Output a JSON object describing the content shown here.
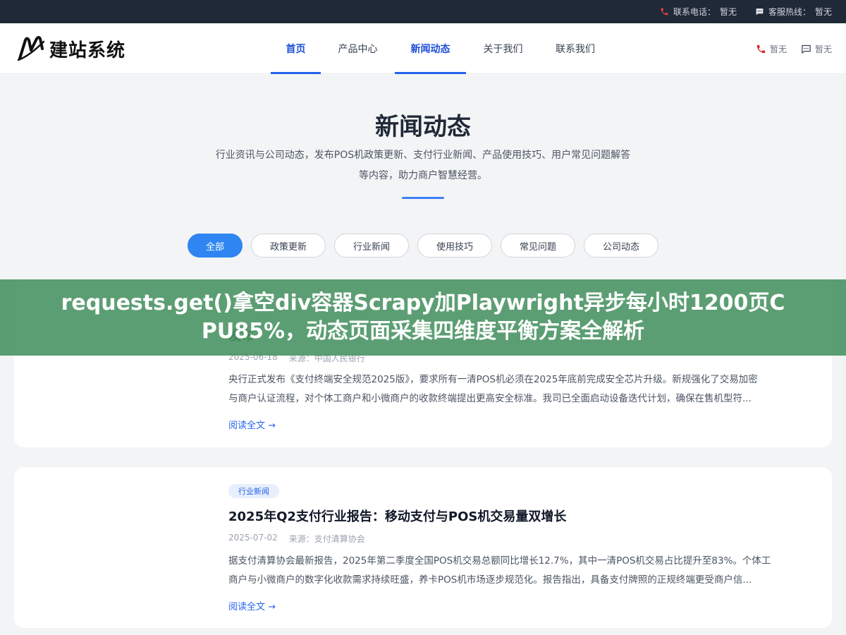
{
  "topbar": {
    "phone_label": "联系电话：",
    "phone_value": "暂无",
    "hotline_label": "客服热线：",
    "hotline_value": "暂无"
  },
  "header": {
    "logo_text": "建站系统",
    "nav": [
      {
        "label": "首页",
        "active": true
      },
      {
        "label": "产品中心",
        "active": false
      },
      {
        "label": "新闻动态",
        "active": true
      },
      {
        "label": "关于我们",
        "active": false
      },
      {
        "label": "联系我们",
        "active": false
      }
    ],
    "phone_value": "暂无",
    "chat_value": "暂无"
  },
  "hero": {
    "title": "新闻动态",
    "desc_line1": "行业资讯与公司动态，发布POS机政策更新、支付行业新闻、产品使用技巧、用户常见问题解答",
    "desc_line2": "等内容，助力商户智慧经营。"
  },
  "filters": [
    {
      "label": "全部",
      "active": true
    },
    {
      "label": "政策更新",
      "active": false
    },
    {
      "label": "行业新闻",
      "active": false
    },
    {
      "label": "使用技巧",
      "active": false
    },
    {
      "label": "常见问题",
      "active": false
    },
    {
      "label": "公司动态",
      "active": false
    }
  ],
  "banner": {
    "line1": "requests.get()拿空div容器Scrapy加Playwright异步每小时1200页C",
    "line2": "PU85%，动态页面采集四维度平衡方案全解析"
  },
  "articles": [
    {
      "title_visible": "发布",
      "date": "2025-06-18",
      "source": "来源：中国人民银行",
      "excerpt_line1": "央行正式发布《支付终端安全规范2025版》，要求所有一清POS机必须在2025年底前完成安全芯片升级。新规强化了交易加密",
      "excerpt_line2": "与商户认证流程，对个体工商户和小微商户的收款终端提出更高安全标准。我司已全面启动设备迭代计划，确保在售机型符...",
      "read_more": "阅读全文 →"
    },
    {
      "tag": "行业新闻",
      "title": "2025年Q2支付行业报告：移动支付与POS机交易量双增长",
      "date": "2025-07-02",
      "source": "来源：支付清算协会",
      "excerpt_line1": "据支付清算协会最新报告，2025年第二季度全国POS机交易总额同比增长12.7%，其中一清POS机交易占比提升至83%。个体工",
      "excerpt_line2": "商户与小微商户的数字化收款需求持续旺盛，养卡POS机市场逐步规范化。报告指出，具备支付牌照的正规终端更受商户信...",
      "read_more": "阅读全文 →"
    }
  ]
}
